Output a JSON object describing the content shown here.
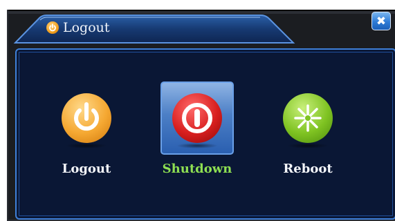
{
  "dialog": {
    "title": "Logout",
    "title_icon": "power-icon",
    "close_icon": "close-icon",
    "close_glyph": "✖"
  },
  "options": [
    {
      "id": "logout",
      "label": "Logout",
      "icon": "power-icon",
      "color": "#f5a832",
      "selected": false
    },
    {
      "id": "shutdown",
      "label": "Shutdown",
      "icon": "power-off-icon",
      "color": "#d81f1f",
      "selected": true
    },
    {
      "id": "reboot",
      "label": "Reboot",
      "icon": "reboot-icon",
      "color": "#7fc322",
      "selected": false
    }
  ],
  "colors": {
    "panel_bg": "#0a1735",
    "panel_border": "#3e7fd8",
    "selected_label": "#8fe052",
    "label": "#f4f6fa",
    "selection_box": "#4c7fc6"
  }
}
